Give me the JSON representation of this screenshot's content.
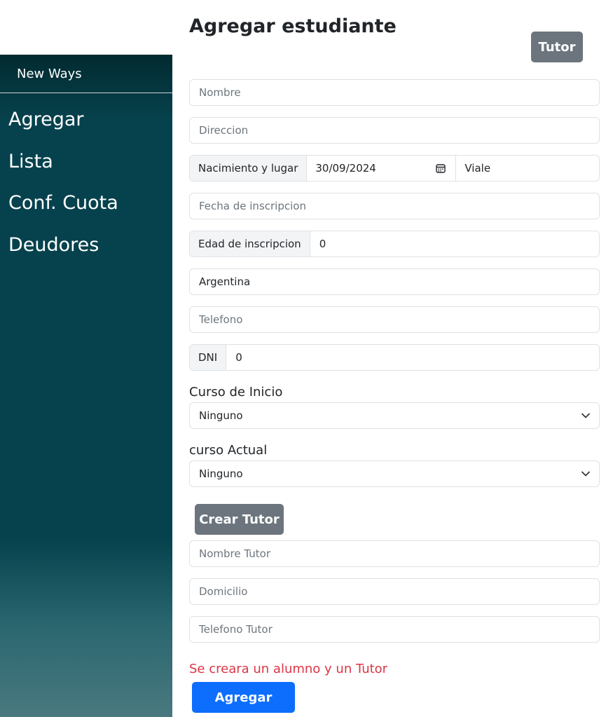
{
  "sidebar": {
    "brand": "New Ways",
    "items": [
      {
        "label": "Agregar"
      },
      {
        "label": "Lista"
      },
      {
        "label": "Conf. Cuota"
      },
      {
        "label": "Deudores"
      }
    ]
  },
  "main": {
    "title": "Agregar estudiante",
    "tutor_button": "Tutor",
    "nombre": {
      "placeholder": "Nombre",
      "value": ""
    },
    "direccion": {
      "placeholder": "Direccion",
      "value": ""
    },
    "nacimiento": {
      "label": "Nacimiento y lugar",
      "date": "30/09/2024",
      "place": "Viale"
    },
    "fecha_inscripcion": {
      "placeholder": "Fecha de inscripcion",
      "value": ""
    },
    "edad": {
      "label": "Edad de inscripcion",
      "value": "0"
    },
    "pais": {
      "value": "Argentina"
    },
    "telefono": {
      "placeholder": "Telefono",
      "value": ""
    },
    "dni": {
      "label": "DNI",
      "value": "0"
    },
    "curso_inicio": {
      "label": "Curso de Inicio",
      "selected": "Ninguno"
    },
    "curso_actual": {
      "label": "curso Actual",
      "selected": "Ninguno"
    },
    "crear_tutor_button": "Crear Tutor",
    "nombre_tutor": {
      "placeholder": "Nombre Tutor",
      "value": ""
    },
    "domicilio": {
      "placeholder": "Domicilio",
      "value": ""
    },
    "telefono_tutor": {
      "placeholder": "Telefono Tutor",
      "value": ""
    },
    "notice": "Se creara un alumno y un Tutor",
    "submit_button": "Agregar"
  },
  "icons": {
    "calendar": "calendar-icon",
    "chevron": "chevron-down-icon"
  },
  "colors": {
    "primary": "#0d6efd",
    "secondary": "#6c757d",
    "danger": "#dc3545",
    "sidebar": "#05424d"
  }
}
